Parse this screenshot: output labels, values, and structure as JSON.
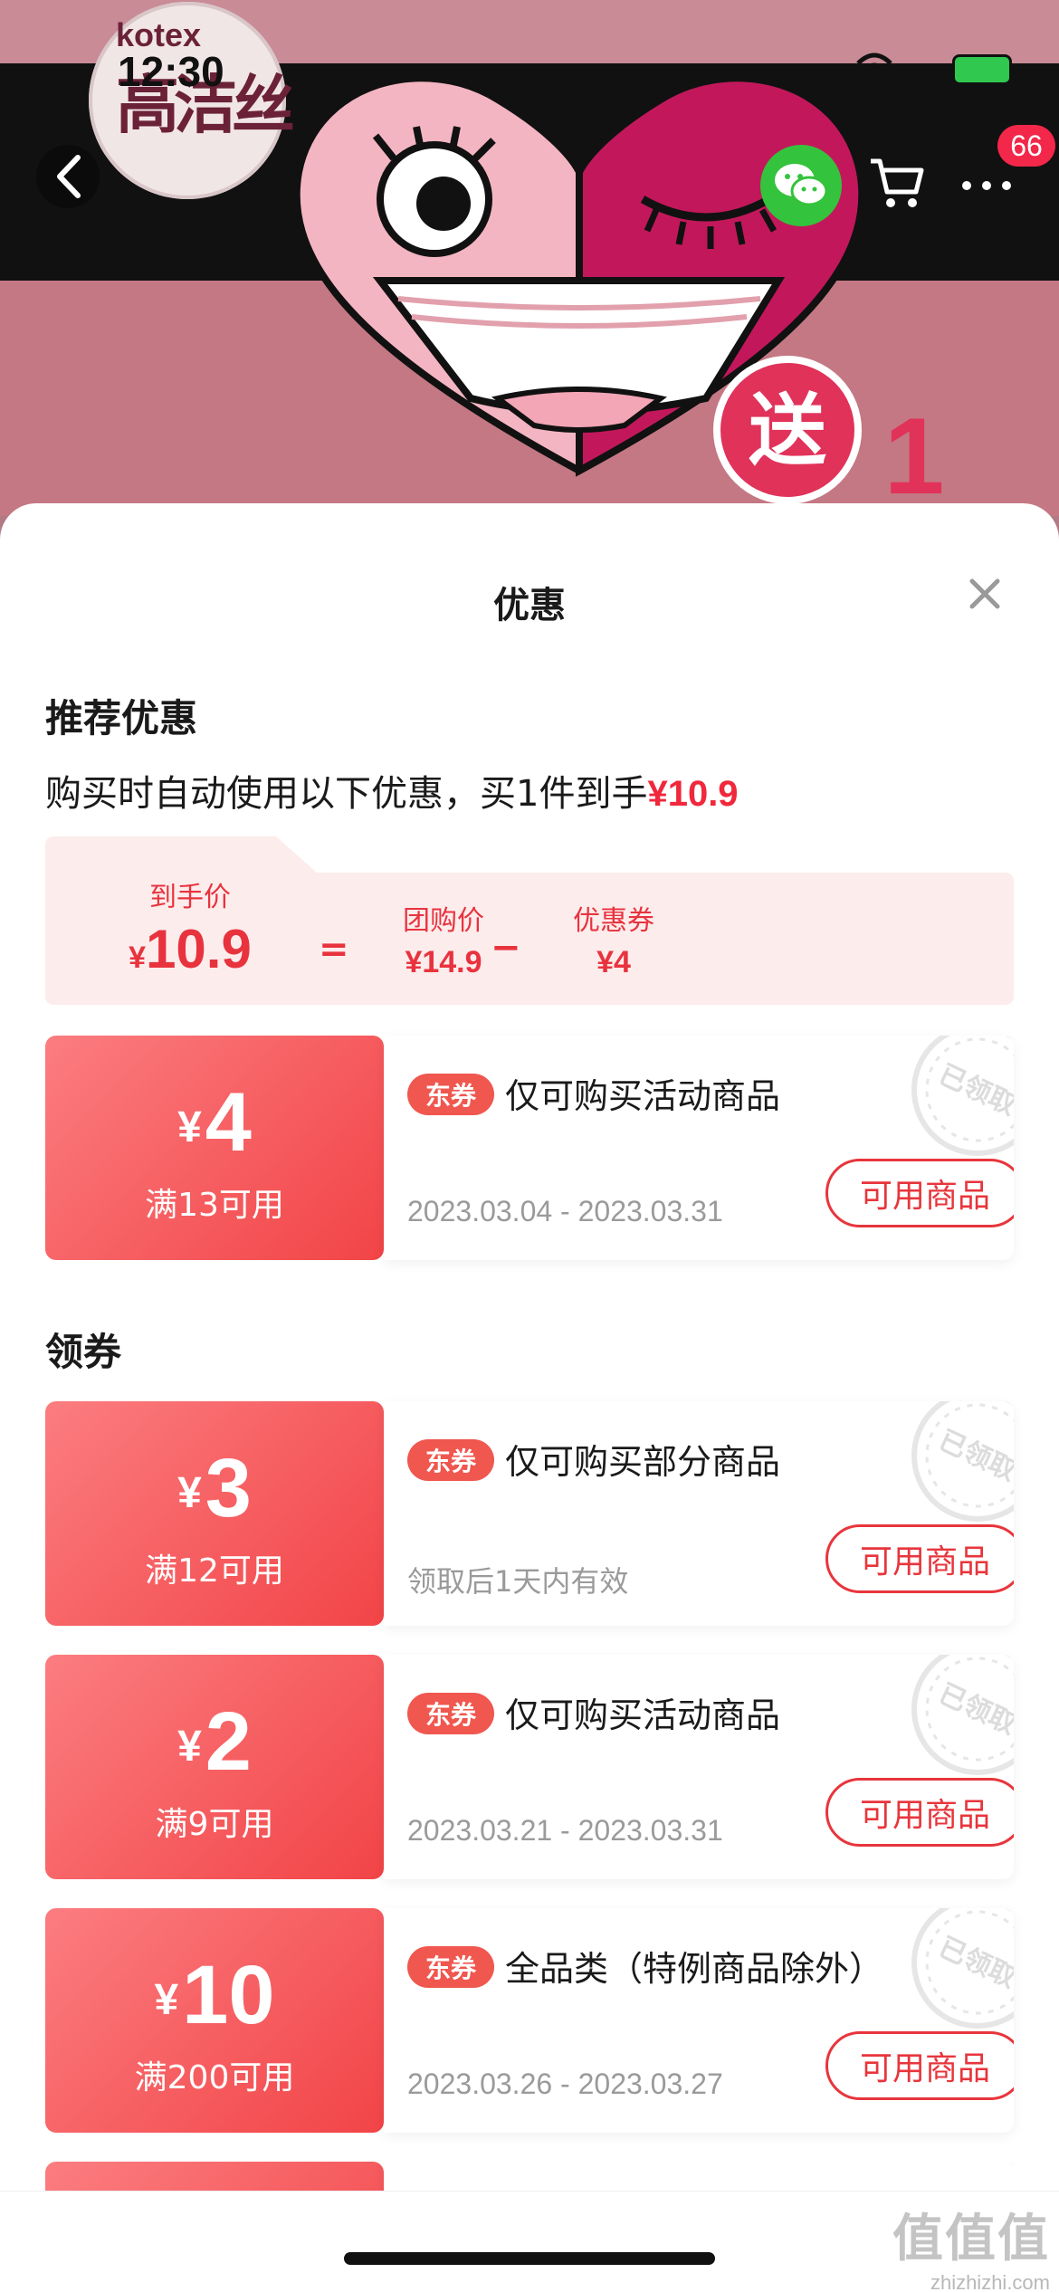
{
  "status_bar": {
    "time": "12:30"
  },
  "header": {
    "brand_latin": "kotex",
    "brand_cn": "高洁丝",
    "cart_badge": "66",
    "icons": [
      "back-icon",
      "wechat-icon",
      "cart-icon",
      "more-icon"
    ]
  },
  "sheet": {
    "title": "优惠",
    "recommended": {
      "title": "推荐优惠",
      "desc_prefix": "购买时自动使用以下优惠，买1件到手",
      "desc_price": "¥10.9",
      "breakdown": {
        "final_label": "到手价",
        "final_yen": "¥",
        "final_value": "10.9",
        "equals": "=",
        "group_label": "团购价",
        "group_value": "¥14.9",
        "minus": "−",
        "coupon_label": "优惠券",
        "coupon_value": "¥4"
      },
      "coupon": {
        "yen": "¥",
        "amount": "4",
        "condition": "满13可用",
        "tag": "东券",
        "desc": "仅可购买活动商品",
        "date": "2023.03.04 - 2023.03.31",
        "button": "可用商品",
        "stamp": "已领取"
      }
    },
    "claim": {
      "title": "领券",
      "coupons": [
        {
          "yen": "¥",
          "amount": "3",
          "condition": "满12可用",
          "tag": "东券",
          "desc": "仅可购买部分商品",
          "date": "领取后1天内有效",
          "button": "可用商品",
          "stamp": "已领取"
        },
        {
          "yen": "¥",
          "amount": "2",
          "condition": "满9可用",
          "tag": "东券",
          "desc": "仅可购买活动商品",
          "date": "2023.03.21 - 2023.03.31",
          "button": "可用商品",
          "stamp": "已领取"
        },
        {
          "yen": "¥",
          "amount": "10",
          "condition": "满200可用",
          "tag": "东券",
          "desc": "全品类（特例商品除外）",
          "date": "2023.03.26 - 2023.03.27",
          "button": "可用商品",
          "stamp": "已领取"
        }
      ]
    }
  },
  "watermark": {
    "cn": "值值值",
    "url": "zhizhizhi.com"
  },
  "colors": {
    "accent": "#f0283c",
    "coupon_gradient_start": "#fb7d80",
    "coupon_gradient_end": "#f24447",
    "wechat": "#34c33d",
    "badge": "#f2274a"
  }
}
